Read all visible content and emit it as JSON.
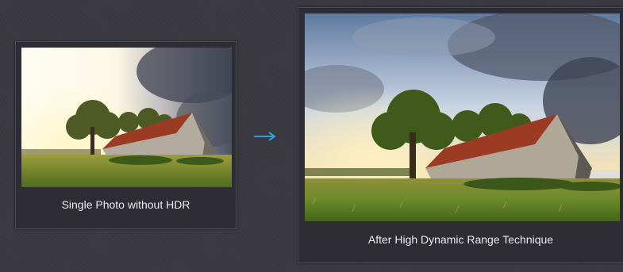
{
  "comparison": {
    "before": {
      "caption": "Single Photo without HDR",
      "image": "photo-barn-without-hdr"
    },
    "after": {
      "caption": "After High Dynamic Range Technique",
      "image": "photo-barn-with-hdr"
    },
    "arrow_icon": "arrow-right-icon"
  },
  "colors": {
    "background": "#3a3940",
    "card": "#2e2d35",
    "card_border": "#4b4a53",
    "caption_text": "#ececef",
    "arrow": "#2f9fd6",
    "barn_roof": "#9c3b24",
    "grass": "#6f8a2b"
  }
}
